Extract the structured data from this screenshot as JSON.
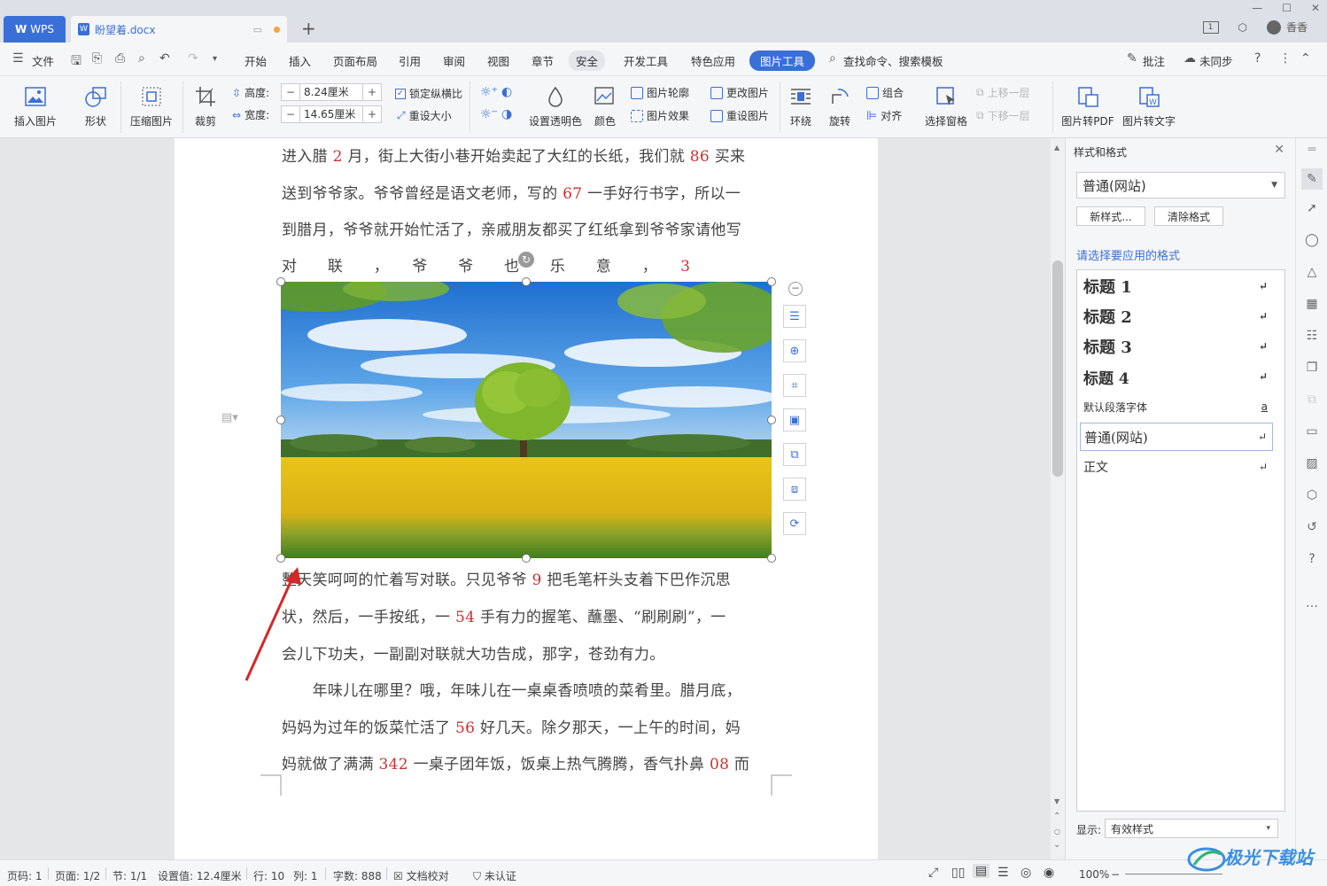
{
  "titlebar": {
    "wps_label": "WPS",
    "doc_name": "盼望着.docx",
    "user": "香香",
    "badge": "1"
  },
  "menu": {
    "file": "文件",
    "items": [
      "开始",
      "插入",
      "页面布局",
      "引用",
      "审阅",
      "视图",
      "章节",
      "安全",
      "开发工具",
      "特色应用",
      "图片工具"
    ],
    "search": "查找命令、搜索模板",
    "comment": "批注",
    "sync": "未同步"
  },
  "ribbon": {
    "insert_image": "插入图片",
    "shape": "形状",
    "compress": "压缩图片",
    "crop": "裁剪",
    "height_label": "高度:",
    "height_value": "8.24厘米",
    "width_label": "宽度:",
    "width_value": "14.65厘米",
    "lock_ratio": "锁定纵横比",
    "reset_size": "重设大小",
    "set_transparent": "设置透明色",
    "color": "颜色",
    "outline": "图片轮廓",
    "effect": "图片效果",
    "change_image": "更改图片",
    "reset_image": "重设图片",
    "wrap": "环绕",
    "rotate": "旋转",
    "group": "组合",
    "align": "对齐",
    "selection_pane": "选择窗格",
    "bring_forward": "上移一层",
    "send_backward": "下移一层",
    "to_pdf": "图片转PDF",
    "to_text": "图片转文字"
  },
  "document": {
    "lines_top": [
      [
        {
          "t": "进入腊 "
        },
        {
          "t": "2",
          "n": true
        },
        {
          "t": " 月，街上大街小巷开始卖起了大红的长纸，我们就 "
        },
        {
          "t": "86",
          "n": true
        },
        {
          "t": " 买来"
        }
      ],
      [
        {
          "t": "送到爷爷家。爷爷曾经是语文老师，写的 "
        },
        {
          "t": "67",
          "n": true
        },
        {
          "t": " 一手好行书字，所以一"
        }
      ],
      [
        {
          "t": "到腊月，爷爷就开始忙活了，亲戚朋友都买了红纸拿到爷爷家请他写"
        }
      ],
      [
        {
          "t": "对　　联　　，　　爷　　爷　　也　　乐　　意　　，　　"
        },
        {
          "t": "3",
          "n": true
        }
      ]
    ],
    "lines_bottom": [
      [
        {
          "t": "整天笑呵呵的忙着写对联。只见爷爷 "
        },
        {
          "t": "9",
          "n": true
        },
        {
          "t": " 把毛笔杆头支着下巴作沉思"
        }
      ],
      [
        {
          "t": "状，然后，一手按纸，一 "
        },
        {
          "t": "54",
          "n": true
        },
        {
          "t": " 手有力的握笔、蘸墨、“刷刷刷”，一"
        }
      ],
      [
        {
          "t": "会儿下功夫，一副副对联就大功告成，那字，苍劲有力。"
        }
      ],
      [
        {
          "t": "　　年味儿在哪里？哦，年味儿在一桌桌香喷喷的菜肴里。腊月底，"
        }
      ],
      [
        {
          "t": "妈妈为过年的饭菜忙活了 "
        },
        {
          "t": "56",
          "n": true
        },
        {
          "t": " 好几天。除夕那天，一上午的时间，妈"
        }
      ],
      [
        {
          "t": "妈就做了满满 "
        },
        {
          "t": "342",
          "n": true
        },
        {
          "t": " 一桌子团年饭，饭桌上热气腾腾，香气扑鼻 "
        },
        {
          "t": "08",
          "n": true
        },
        {
          "t": " 而"
        }
      ]
    ]
  },
  "panel": {
    "title": "样式和格式",
    "current_style": "普通(网站)",
    "new_style": "新样式...",
    "clear_format": "清除格式",
    "apply_label": "请选择要应用的格式",
    "styles": [
      "标题  1",
      "标题  2",
      "标题  3",
      "标题  4",
      "默认段落字体",
      "普通(网站)",
      "正文"
    ],
    "show_label": "显示:",
    "show_value": "有效样式"
  },
  "status": {
    "page_code": "页码: 1",
    "page": "页面: 1/2",
    "section": "节: 1/1",
    "setting": "设置值: 12.4厘米",
    "row": "行: 10",
    "col": "列: 1",
    "words": "字数: 888",
    "proof": "文档校对",
    "cert": "未认证",
    "zoom": "100%"
  },
  "watermark": "极光下载站",
  "colors": {
    "accent": "#3a6fd8",
    "number_red": "#d03030",
    "arrow_red": "#d42828"
  }
}
